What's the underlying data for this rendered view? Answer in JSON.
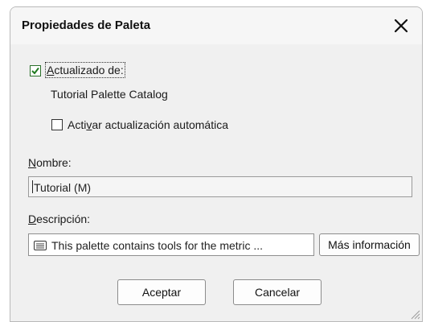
{
  "dialog": {
    "title": "Propiedades de Paleta",
    "close_icon": "close-icon"
  },
  "update_from": {
    "checked": true,
    "label_mnemonic": "A",
    "label_rest": "ctualizado de:",
    "source": "Tutorial Palette Catalog"
  },
  "auto_update": {
    "checked": false,
    "label_pre": "Acti",
    "label_mnemonic": "v",
    "label_post": "ar actualización automática"
  },
  "name": {
    "label_mnemonic": "N",
    "label_rest": "ombre:",
    "value": "Tutorial (M)"
  },
  "description": {
    "label_mnemonic": "D",
    "label_rest": "escripción:",
    "icon": "notes-icon",
    "value": "This palette contains tools for the metric ...",
    "more_info_button": "Más información"
  },
  "buttons": {
    "ok": "Aceptar",
    "cancel": "Cancelar"
  }
}
